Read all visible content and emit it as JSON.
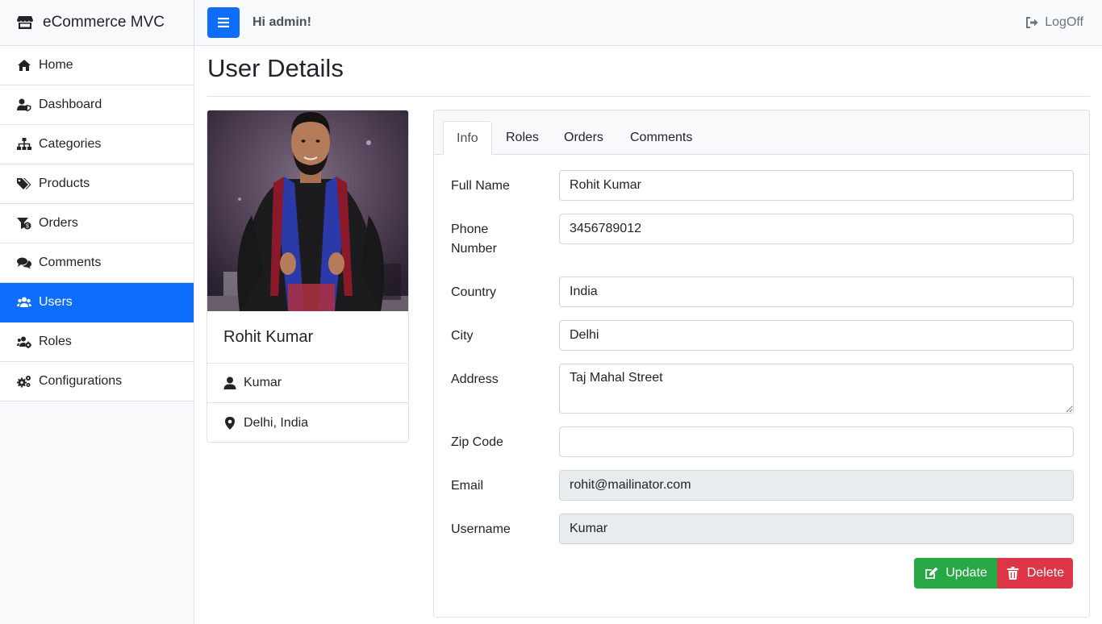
{
  "app": {
    "brand": "eCommerce MVC",
    "greeting": "Hi admin!",
    "logoff": "LogOff"
  },
  "sidebar": {
    "items": [
      {
        "label": "Home",
        "icon": "home-icon"
      },
      {
        "label": "Dashboard",
        "icon": "user-shield-icon"
      },
      {
        "label": "Categories",
        "icon": "sitemap-icon"
      },
      {
        "label": "Products",
        "icon": "tags-icon"
      },
      {
        "label": "Orders",
        "icon": "funnel-dollar-icon"
      },
      {
        "label": "Comments",
        "icon": "comments-icon"
      },
      {
        "label": "Users",
        "icon": "users-icon",
        "active": true
      },
      {
        "label": "Roles",
        "icon": "users-cog-icon"
      },
      {
        "label": "Configurations",
        "icon": "cogs-icon"
      }
    ]
  },
  "page": {
    "title": "User Details"
  },
  "profile": {
    "name": "Rohit Kumar",
    "username": "Kumar",
    "location": "Delhi, India"
  },
  "tabs": [
    "Info",
    "Roles",
    "Orders",
    "Comments"
  ],
  "form": {
    "full_name_label": "Full Name",
    "full_name": "Rohit Kumar",
    "phone_label_1": "Phone",
    "phone_label_2": "Number",
    "phone": "3456789012",
    "country_label": "Country",
    "country": "India",
    "city_label": "City",
    "city": "Delhi",
    "address_label": "Address",
    "address": "Taj Mahal Street",
    "zip_label": "Zip Code",
    "zip": "",
    "email_label": "Email",
    "email": "rohit@mailinator.com",
    "username_label": "Username",
    "username": "Kumar"
  },
  "actions": {
    "update": "Update",
    "delete": "Delete"
  },
  "colors": {
    "primary": "#0d6efd",
    "success": "#28a745",
    "danger": "#dc3545"
  }
}
